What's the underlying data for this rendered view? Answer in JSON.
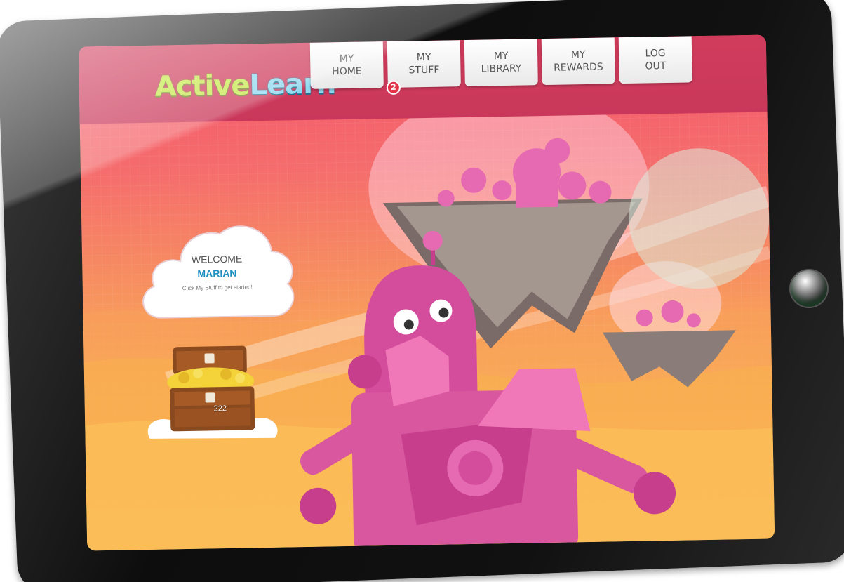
{
  "app": {
    "logo_part1": "Active",
    "logo_part2": "Learn"
  },
  "nav": {
    "tabs": [
      {
        "line1": "MY",
        "line2": "HOME"
      },
      {
        "line1": "MY",
        "line2": "STUFF",
        "badge": "2"
      },
      {
        "line1": "MY",
        "line2": "LIBRARY"
      },
      {
        "line1": "MY",
        "line2": "REWARDS"
      },
      {
        "line1": "LOG",
        "line2": "OUT"
      }
    ]
  },
  "welcome": {
    "title": "WELCOME",
    "name": "MARIAN",
    "hint": "Click My Stuff to get started!"
  },
  "rewards": {
    "coins": "222"
  },
  "icons": {
    "logo": "activelearn-logo",
    "badge": "notification-badge",
    "treasure": "treasure-chest-icon",
    "robot": "robot-illustration"
  },
  "colors": {
    "header": "#c9385a",
    "badge": "#e3344a",
    "name": "#1f8fc2",
    "logo_green": "#c6e84a",
    "logo_blue": "#8fd8ef"
  }
}
